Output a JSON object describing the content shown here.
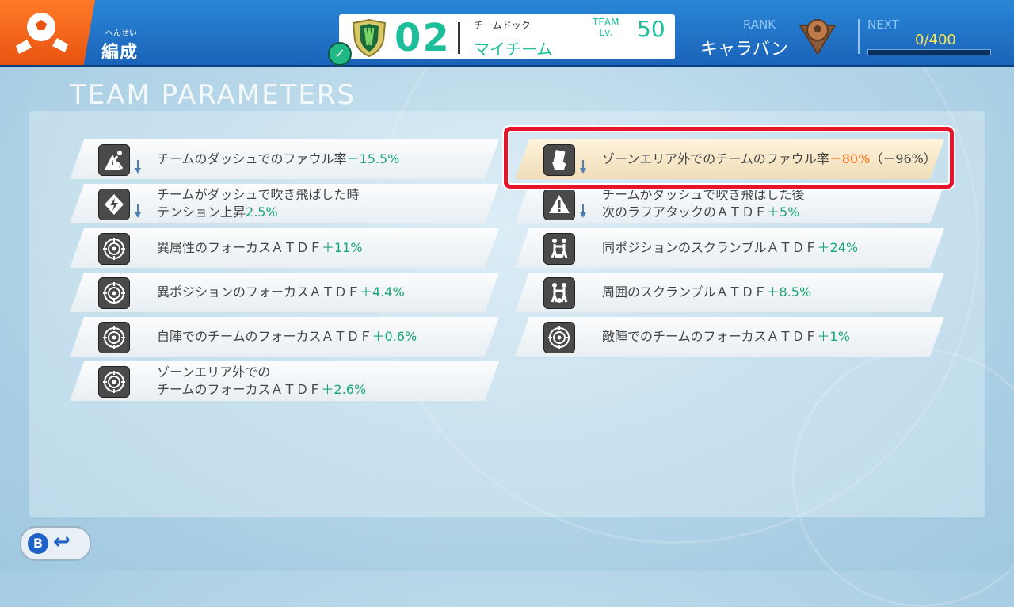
{
  "header": {
    "menu_title": "編成",
    "menu_ruby": "へんせい",
    "team_number": "02",
    "team_dock_label": "チームドック",
    "team_name": "マイチーム",
    "team_lv_label": "TEAM Lv.",
    "team_lv": "50",
    "rank_label": "RANK",
    "rank_value": "キャラバン",
    "next_label": "NEXT",
    "next_value": "0/400",
    "next_progress": 0
  },
  "section_title": "TEAM PARAMETERS",
  "left_params": [
    {
      "icon": "foul-dash-icon",
      "arrow": true,
      "text": "チームのダッシュでのファウル率",
      "value": "－15.5%",
      "value_type": "pos"
    },
    {
      "icon": "lightning-icon",
      "arrow": true,
      "line1": "チームがダッシュで吹き飛ばした時",
      "line2": "テンション上昇",
      "value": "2.5%",
      "value_type": "pos"
    },
    {
      "icon": "focus-target-icon",
      "arrow": false,
      "text": "異属性のフォーカスＡＴＤＦ",
      "value": "＋11%",
      "value_type": "pos"
    },
    {
      "icon": "focus-target-icon",
      "arrow": false,
      "text": "異ポジションのフォーカスＡＴＤＦ",
      "value": "＋4.4%",
      "value_type": "pos"
    },
    {
      "icon": "focus-target-icon",
      "arrow": false,
      "text": "自陣でのチームのフォーカスＡＴＤＦ",
      "value": "＋0.6%",
      "value_type": "pos"
    },
    {
      "icon": "focus-target-icon",
      "arrow": false,
      "line1": "ゾーンエリア外での",
      "line2": "チームのフォーカスＡＴＤＦ",
      "value": "＋2.6%",
      "value_type": "pos"
    }
  ],
  "right_params": [
    {
      "icon": "card-hand-icon",
      "arrow": true,
      "text": "ゾーンエリア外でのチームのファウル率",
      "value": "－80%",
      "value_type": "neg",
      "extra": "（－96%）",
      "highlighted": true
    },
    {
      "icon": "warning-icon",
      "arrow": true,
      "line1": "チームがダッシュで吹き飛ばした後",
      "line2": "次のラフアタックのＡＴＤＦ",
      "value": "＋5%",
      "value_type": "pos"
    },
    {
      "icon": "scramble-icon",
      "arrow": false,
      "text": "同ポジションのスクランブルＡＴＤＦ",
      "value": "＋24%",
      "value_type": "pos"
    },
    {
      "icon": "scramble-icon",
      "arrow": false,
      "text": "周囲のスクランブルＡＴＤＦ",
      "value": "＋8.5%",
      "value_type": "pos"
    },
    {
      "icon": "focus-target-icon",
      "arrow": false,
      "text": "敵陣でのチームのフォーカスＡＴＤＦ",
      "value": "＋1%",
      "value_type": "pos"
    }
  ],
  "back_button": {
    "key": "B",
    "icon": "return-arrow-icon"
  }
}
